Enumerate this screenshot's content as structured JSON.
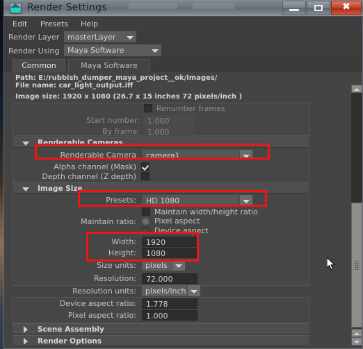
{
  "window": {
    "title": "Render Settings",
    "icon": "maya-render-settings-icon",
    "ghost_labels": [
      "",
      ""
    ],
    "controls": {
      "minimize": "minimize-icon",
      "maximize": "maximize-icon",
      "close": "✖"
    }
  },
  "menubar": {
    "items": [
      "Edit",
      "Presets",
      "Help"
    ]
  },
  "render_layer": {
    "label": "Render Layer",
    "value": "masterLayer"
  },
  "render_using": {
    "label": "Render Using",
    "value": "Maya Software"
  },
  "tabs": [
    {
      "label": "Common",
      "active": true
    },
    {
      "label": "Maya Software",
      "active": false
    }
  ],
  "info": {
    "path": "Path: E:/rubbish_dumper_maya_project__ok/images/",
    "file_name": "File name:  car_light_output.iff",
    "image_size": "Image size: 1920 x 1080 (26.7 x 15 inches 72 pixels/inch )"
  },
  "renumber": {
    "checkbox_label": "Renumber frames",
    "checked": false,
    "start_number": {
      "label": "Start number:",
      "value": "1.000",
      "enabled": false
    },
    "by_frame": {
      "label": "By frame:",
      "value": "1.000",
      "enabled": false
    }
  },
  "sections": {
    "renderable_cameras": {
      "title": "Renderable Cameras",
      "expanded": true
    },
    "image_size": {
      "title": "Image Size",
      "expanded": true
    },
    "scene_assembly": {
      "title": "Scene Assembly",
      "expanded": false
    },
    "render_options": {
      "title": "Render Options",
      "expanded": false
    }
  },
  "renderable_camera": {
    "label": "Renderable Camera",
    "value": "camera1"
  },
  "alpha_channel": {
    "label": "Alpha channel (Mask)",
    "checked": true
  },
  "depth_channel": {
    "label": "Depth channel (Z depth)",
    "checked": false
  },
  "presets": {
    "label": "Presets:",
    "value": "HD 1080"
  },
  "maintain_wh_ratio": {
    "label": "Maintain width/height ratio",
    "checked": false
  },
  "maintain_ratio": {
    "label": "Maintain ratio:",
    "options": [
      "Pixel aspect",
      "Device aspect"
    ],
    "selected": "Pixel aspect"
  },
  "width": {
    "label": "Width:",
    "value": "1920"
  },
  "height": {
    "label": "Height:",
    "value": "1080"
  },
  "size_units": {
    "label": "Size units:",
    "value": "pixels"
  },
  "resolution": {
    "label": "Resolution:",
    "value": "72.000"
  },
  "resolution_units": {
    "label": "Resolution units:",
    "value": "pixels/inch"
  },
  "device_aspect_ratio": {
    "label": "Device aspect ratio:",
    "value": "1.778"
  },
  "pixel_aspect_ratio": {
    "label": "Pixel aspect ratio:",
    "value": "1.000"
  },
  "colors": {
    "annotation": "#f01414",
    "panel": "#444444",
    "section_header": "#4e4e4e",
    "field": "#2d2d2d",
    "close_button": "#c33f27"
  }
}
